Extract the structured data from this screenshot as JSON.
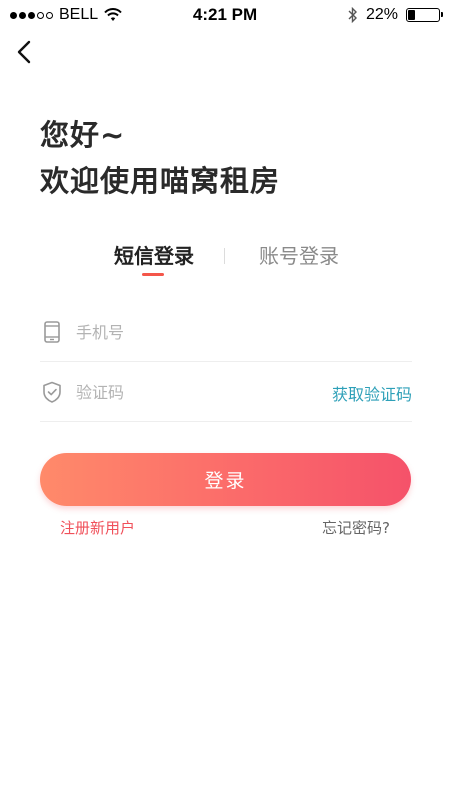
{
  "status_bar": {
    "carrier": "BELL",
    "time": "4:21 PM",
    "battery": "22%",
    "battery_level": 0.22,
    "icons": [
      "signal-dots-icon",
      "wifi-icon",
      "bluetooth-icon",
      "battery-icon"
    ]
  },
  "nav": {
    "back_icon": "chevron-left-icon"
  },
  "greeting": {
    "line1": "您好~",
    "line2": "欢迎使用喵窝租房"
  },
  "tabs": [
    {
      "label": "短信登录",
      "active": true
    },
    {
      "label": "账号登录",
      "active": false
    }
  ],
  "form": {
    "phone": {
      "placeholder": "手机号",
      "value": "",
      "icon": "phone-icon"
    },
    "code": {
      "placeholder": "验证码",
      "value": "",
      "icon": "shield-check-icon"
    },
    "get_code_label": "获取验证码",
    "login_label": "登录"
  },
  "links": {
    "register": "注册新用户",
    "forgot": "忘记密码?"
  },
  "colors": {
    "accent": "#f4564a",
    "link_teal": "#2ea0b8",
    "button_gradient_start": "#ff8a6a",
    "button_gradient_end": "#f5526a"
  }
}
